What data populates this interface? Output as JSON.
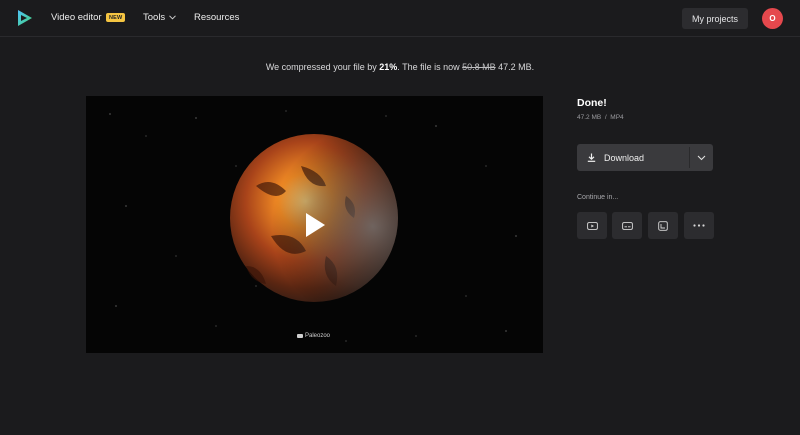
{
  "header": {
    "logo": "play-triangle-logo",
    "nav": {
      "video_editor": "Video editor",
      "badge": "NEW",
      "tools": "Tools",
      "resources": "Resources"
    },
    "my_projects": "My projects",
    "avatar_initial": "O",
    "colors": {
      "badge": "#f5c542",
      "avatar": "#e5484d"
    }
  },
  "status": {
    "prefix": "We compressed your file by ",
    "percent": "21%",
    "middle": ". The file is now ",
    "old_size": "50.8 MB",
    "new_size": " 47.2 MB."
  },
  "player": {
    "watermark": "Paleozoo",
    "play_icon": "play-icon"
  },
  "result": {
    "title": "Done!",
    "size": "47.2 MB",
    "separator": "/",
    "format": "MP4",
    "download_label": "Download",
    "continue_label": "Continue in...",
    "continue_tools": [
      "youtube-icon",
      "subtitles-icon",
      "crop-icon",
      "more-icon"
    ]
  }
}
